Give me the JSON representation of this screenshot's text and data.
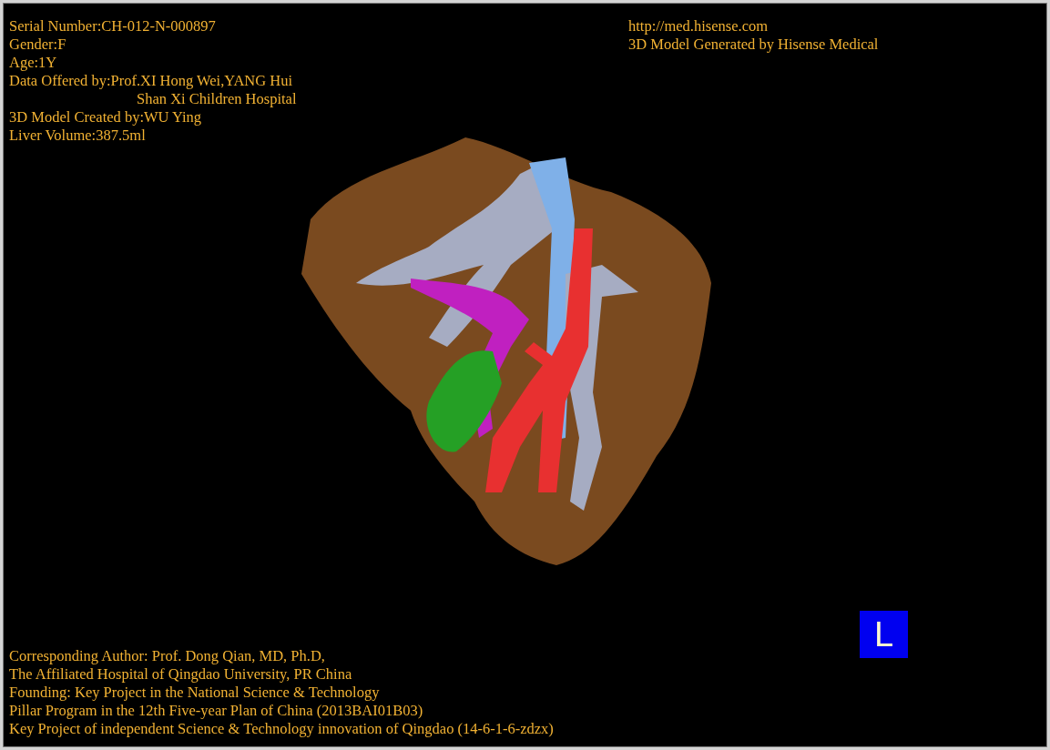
{
  "info_left": [
    {
      "text": "Serial Number:CH-012-N-000897",
      "indented": false
    },
    {
      "text": "Gender:F",
      "indented": false
    },
    {
      "text": "Age:1Y",
      "indented": false
    },
    {
      "text": "Data Offered by:Prof.XI Hong Wei,YANG Hui",
      "indented": false
    },
    {
      "text": "Shan Xi Children Hospital",
      "indented": true
    },
    {
      "text": "3D Model Created by:WU Ying",
      "indented": false
    },
    {
      "text": "Liver Volume:387.5ml",
      "indented": false
    }
  ],
  "info_right": [
    "http://med.hisense.com",
    "3D Model Generated by Hisense Medical"
  ],
  "orientation_badge": "L",
  "footer": [
    "Corresponding Author: Prof. Dong Qian, MD, Ph.D,",
    "The Affiliated Hospital of Qingdao University, PR China",
    "Founding: Key Project in the National Science & Technology",
    "Pillar Program in the 12th Five-year Plan of China (2013BAI01B03)",
    "Key Project of independent Science & Technology innovation of Qingdao (14-6-1-6-zdzx)"
  ]
}
